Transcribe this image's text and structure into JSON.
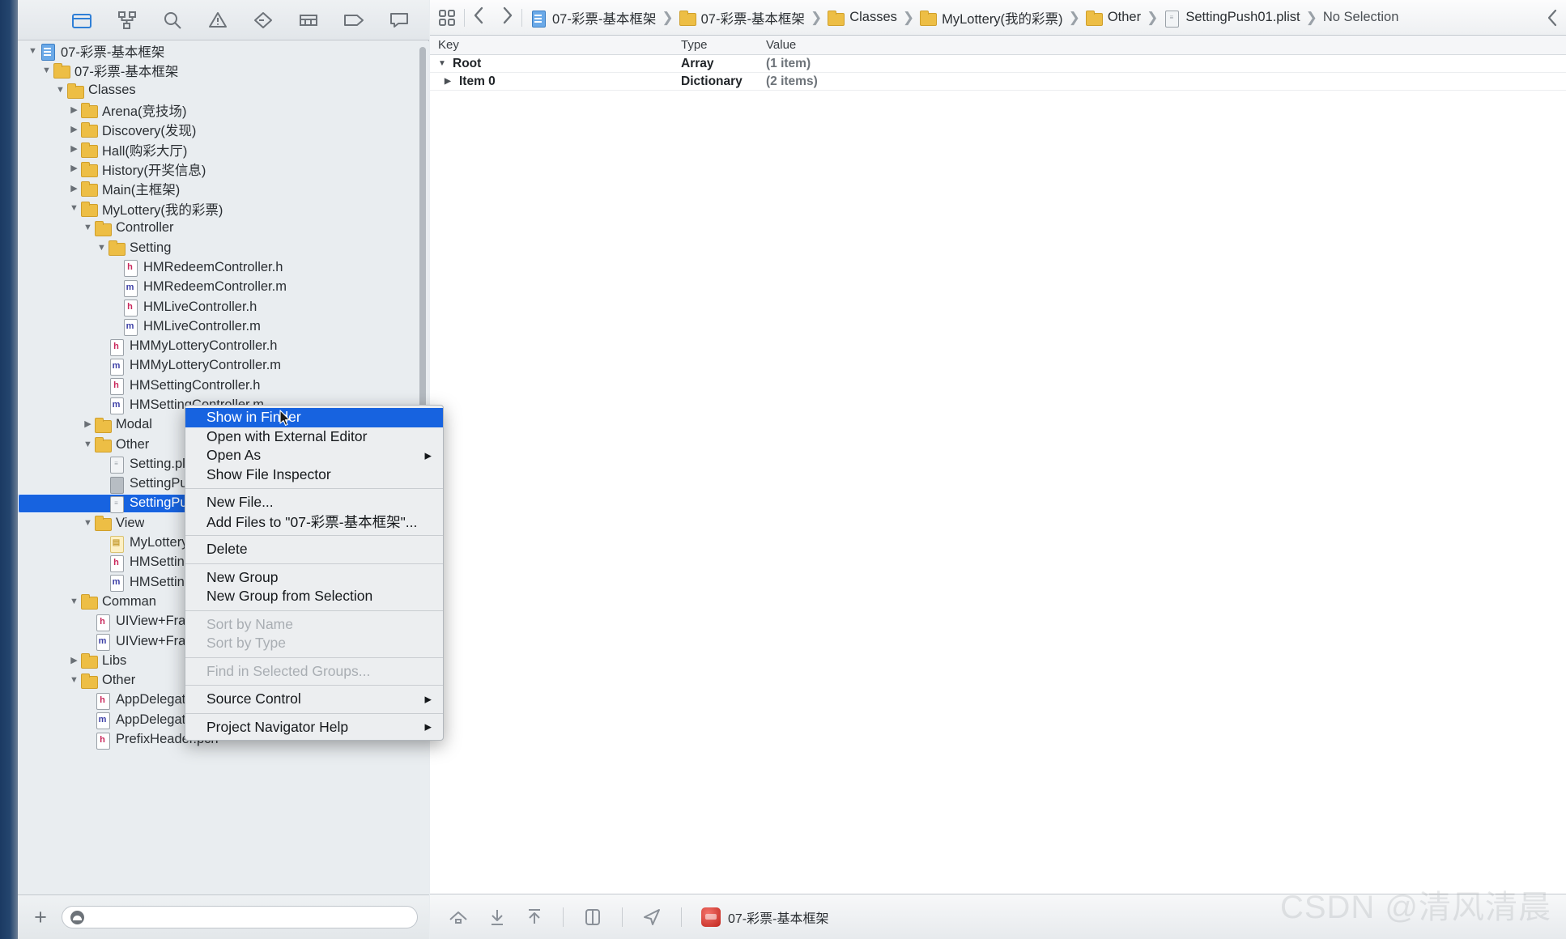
{
  "navigator": {
    "toolbar_icons": [
      {
        "name": "folder-icon",
        "label": "Project navigator",
        "active": true
      },
      {
        "name": "source-control-icon",
        "label": "Source control navigator",
        "active": false
      },
      {
        "name": "search-icon",
        "label": "Find navigator",
        "active": false
      },
      {
        "name": "warning-triangle-icon",
        "label": "Issue navigator",
        "active": false
      },
      {
        "name": "test-diamond-icon",
        "label": "Test navigator",
        "active": false
      },
      {
        "name": "debug-icon",
        "label": "Debug navigator",
        "active": false
      },
      {
        "name": "breakpoint-tag-icon",
        "label": "Breakpoint navigator",
        "active": false
      },
      {
        "name": "report-message-icon",
        "label": "Report navigator",
        "active": false
      }
    ],
    "tree": [
      {
        "label": "07-彩票-基本框架",
        "indent": 0,
        "twisty": "down",
        "icon": "project"
      },
      {
        "label": "07-彩票-基本框架",
        "indent": 1,
        "twisty": "down",
        "icon": "folder"
      },
      {
        "label": "Classes",
        "indent": 2,
        "twisty": "down",
        "icon": "folder"
      },
      {
        "label": "Arena(竞技场)",
        "indent": 3,
        "twisty": "right",
        "icon": "folder"
      },
      {
        "label": "Discovery(发现)",
        "indent": 3,
        "twisty": "right",
        "icon": "folder"
      },
      {
        "label": "Hall(购彩大厅)",
        "indent": 3,
        "twisty": "right",
        "icon": "folder"
      },
      {
        "label": "History(开奖信息)",
        "indent": 3,
        "twisty": "right",
        "icon": "folder"
      },
      {
        "label": "Main(主框架)",
        "indent": 3,
        "twisty": "right",
        "icon": "folder"
      },
      {
        "label": "MyLottery(我的彩票)",
        "indent": 3,
        "twisty": "down",
        "icon": "folder"
      },
      {
        "label": "Controller",
        "indent": 4,
        "twisty": "down",
        "icon": "folder"
      },
      {
        "label": "Setting",
        "indent": 5,
        "twisty": "down",
        "icon": "folder"
      },
      {
        "label": "HMRedeemController.h",
        "indent": 6,
        "twisty": "none",
        "icon": "h"
      },
      {
        "label": "HMRedeemController.m",
        "indent": 6,
        "twisty": "none",
        "icon": "m"
      },
      {
        "label": "HMLiveController.h",
        "indent": 6,
        "twisty": "none",
        "icon": "h"
      },
      {
        "label": "HMLiveController.m",
        "indent": 6,
        "twisty": "none",
        "icon": "m"
      },
      {
        "label": "HMMyLotteryController.h",
        "indent": 5,
        "twisty": "none",
        "icon": "h"
      },
      {
        "label": "HMMyLotteryController.m",
        "indent": 5,
        "twisty": "none",
        "icon": "m"
      },
      {
        "label": "HMSettingController.h",
        "indent": 5,
        "twisty": "none",
        "icon": "h"
      },
      {
        "label": "HMSettingController.m",
        "indent": 5,
        "twisty": "none",
        "icon": "m"
      },
      {
        "label": "Modal",
        "indent": 4,
        "twisty": "right",
        "icon": "folder"
      },
      {
        "label": "Other",
        "indent": 4,
        "twisty": "down",
        "icon": "folder"
      },
      {
        "label": "Setting.plist",
        "indent": 5,
        "twisty": "none",
        "icon": "plist"
      },
      {
        "label": "SettingPush.plist",
        "indent": 5,
        "twisty": "none",
        "icon": "blank"
      },
      {
        "label": "SettingPush01.plist",
        "indent": 5,
        "twisty": "none",
        "icon": "plist",
        "selected": true
      },
      {
        "label": "View",
        "indent": 4,
        "twisty": "down",
        "icon": "folder"
      },
      {
        "label": "MyLottery.storyboard",
        "indent": 5,
        "twisty": "none",
        "icon": "story"
      },
      {
        "label": "HMSettingCell.h",
        "indent": 5,
        "twisty": "none",
        "icon": "h"
      },
      {
        "label": "HMSettingCell.m",
        "indent": 5,
        "twisty": "none",
        "icon": "m"
      },
      {
        "label": "Comman",
        "indent": 3,
        "twisty": "down",
        "icon": "folder"
      },
      {
        "label": "UIView+Frame.h",
        "indent": 4,
        "twisty": "none",
        "icon": "h"
      },
      {
        "label": "UIView+Frame.m",
        "indent": 4,
        "twisty": "none",
        "icon": "m"
      },
      {
        "label": "Libs",
        "indent": 3,
        "twisty": "right",
        "icon": "folder"
      },
      {
        "label": "Other",
        "indent": 3,
        "twisty": "down",
        "icon": "folder"
      },
      {
        "label": "AppDelegate.h",
        "indent": 4,
        "twisty": "none",
        "icon": "h"
      },
      {
        "label": "AppDelegate.m",
        "indent": 4,
        "twisty": "none",
        "icon": "m"
      },
      {
        "label": "PrefixHeader.pch",
        "indent": 4,
        "twisty": "none",
        "icon": "h"
      }
    ],
    "footer": {
      "add_label": "+",
      "filter_placeholder": ""
    }
  },
  "jump_bar": {
    "crumbs": [
      {
        "label": "07-彩票-基本框架",
        "icon": "project"
      },
      {
        "label": "07-彩票-基本框架",
        "icon": "folder"
      },
      {
        "label": "Classes",
        "icon": "folder"
      },
      {
        "label": "MyLottery(我的彩票)",
        "icon": "folder"
      },
      {
        "label": "Other",
        "icon": "folder"
      },
      {
        "label": "SettingPush01.plist",
        "icon": "plist"
      },
      {
        "label": "No Selection",
        "icon": "none"
      }
    ],
    "separator": "❯"
  },
  "plist": {
    "columns": [
      "Key",
      "Type",
      "Value"
    ],
    "rows": [
      {
        "key": "Root",
        "type": "Array",
        "value": "(1 item)",
        "indent": 0,
        "twisty": "down",
        "bold": true
      },
      {
        "key": "Item 0",
        "type": "Dictionary",
        "value": "(2 items)",
        "indent": 1,
        "twisty": "right",
        "bold": true
      }
    ]
  },
  "context_menu": {
    "groups": [
      [
        {
          "label": "Show in Finder",
          "highlight": true
        },
        {
          "label": "Open with External Editor"
        },
        {
          "label": "Open As",
          "submenu": true
        },
        {
          "label": "Show File Inspector"
        }
      ],
      [
        {
          "label": "New File..."
        },
        {
          "label": "Add Files to \"07-彩票-基本框架\"..."
        }
      ],
      [
        {
          "label": "Delete"
        }
      ],
      [
        {
          "label": "New Group"
        },
        {
          "label": "New Group from Selection"
        }
      ],
      [
        {
          "label": "Sort by Name",
          "disabled": true
        },
        {
          "label": "Sort by Type",
          "disabled": true
        }
      ],
      [
        {
          "label": "Find in Selected Groups...",
          "disabled": true
        }
      ],
      [
        {
          "label": "Source Control",
          "submenu": true
        }
      ],
      [
        {
          "label": "Project Navigator Help",
          "submenu": true
        }
      ]
    ],
    "submenu_arrow": "▶"
  },
  "status_bar": {
    "icons": [
      {
        "name": "home-icon"
      },
      {
        "name": "download-icon"
      },
      {
        "name": "upload-icon"
      },
      {
        "name": "split-view-icon"
      },
      {
        "name": "location-arrow-icon"
      }
    ],
    "scheme_label": "07-彩票-基本框架"
  },
  "watermark": "CSDN @清风清晨"
}
